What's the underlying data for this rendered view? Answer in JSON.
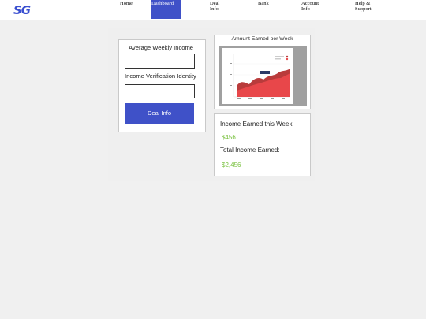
{
  "app": {
    "logo": "SG"
  },
  "nav": {
    "items": [
      {
        "line1": "Home",
        "line2": ""
      },
      {
        "line1": "Dashboard",
        "line2": ""
      },
      {
        "line1": "Deal",
        "line2": "Info"
      },
      {
        "line1": "Bank",
        "line2": ""
      },
      {
        "line1": "Account",
        "line2": "Info"
      },
      {
        "line1": "Help &",
        "line2": "Support"
      }
    ],
    "active": "Dashboard"
  },
  "income_form": {
    "weekly_income_label": "Average Weekly Income",
    "weekly_income_value": "",
    "verification_label": "Income Verification Identity",
    "verification_value": "",
    "submit_label": "Deal Info"
  },
  "chart": {
    "title": "Amount Earned per Week",
    "colors": {
      "area": "#e8474a",
      "area_dark": "#b93b3b",
      "tooltip": "#2b3a67"
    }
  },
  "earnings": {
    "this_week_label": "Income Earned this Week:",
    "this_week_value": "$456",
    "total_label": "Total Income Earned:",
    "total_value": "$2,456"
  },
  "colors": {
    "accent": "#3f51c8",
    "money": "#7bc242"
  }
}
